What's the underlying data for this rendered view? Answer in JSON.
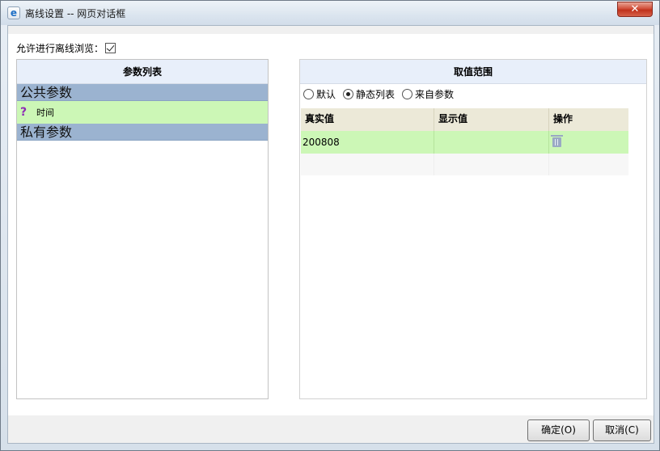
{
  "window": {
    "title": "离线设置 -- 网页对话框",
    "close_label": "✕"
  },
  "allow_offline": {
    "label": "允许进行离线浏览：",
    "checked": true
  },
  "left_panel": {
    "header": "参数列表",
    "groups": [
      {
        "label": "公共参数",
        "items": [
          {
            "icon": "question-icon",
            "label": "时间"
          }
        ]
      },
      {
        "label": "私有参数",
        "items": []
      }
    ]
  },
  "right_panel": {
    "header": "取值范围",
    "radio_options": [
      {
        "label": "默认",
        "checked": false
      },
      {
        "label": "静态列表",
        "checked": true
      },
      {
        "label": "来自参数",
        "checked": false
      }
    ],
    "grid": {
      "columns": [
        "真实值",
        "显示值",
        "操作"
      ],
      "rows": [
        {
          "real_value": "200808",
          "display_value": "",
          "action_icon": "trash-icon"
        }
      ]
    }
  },
  "buttons": {
    "ok": "确定(O)",
    "cancel": "取消(C)"
  },
  "colors": {
    "group_row": "#9bb3d0",
    "selected_row": "#ccf7b6",
    "panel_header": "#e8effa",
    "grid_header": "#ece9d8"
  }
}
